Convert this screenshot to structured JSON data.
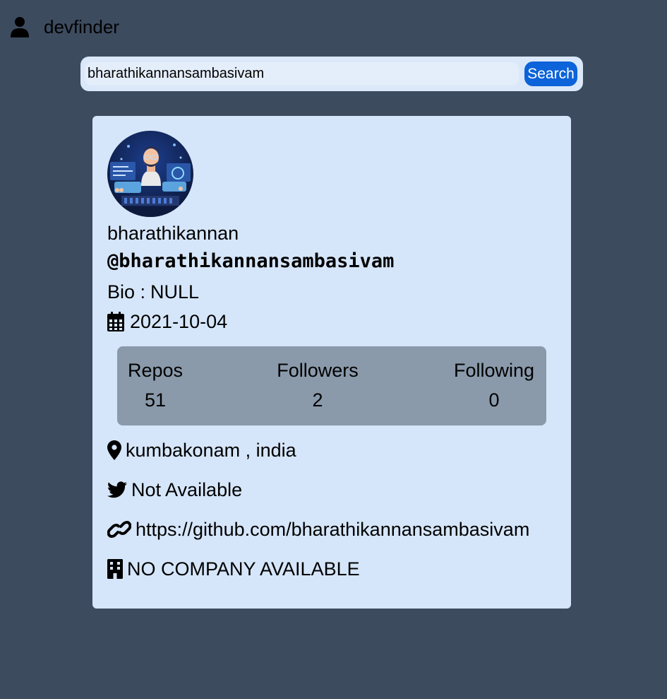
{
  "header": {
    "app_title": "devfinder",
    "icon": "user-icon"
  },
  "search": {
    "value": "bharathikannansambasivam",
    "button_label": "Search"
  },
  "profile": {
    "name": "bharathikannan",
    "login": "@bharathikannansambasivam",
    "bio_label": "Bio :",
    "bio_value": "NULL",
    "joined": "2021-10-04",
    "stats": {
      "repos_label": "Repos",
      "repos_value": "51",
      "followers_label": "Followers",
      "followers_value": "2",
      "following_label": "Following",
      "following_value": "0"
    },
    "location": "kumbakonam , india",
    "twitter": "Not Available",
    "blog": "https://github.com/bharathikannansambasivam",
    "company": "NO COMPANY AVAILABLE"
  },
  "icons": {
    "header": "user-icon",
    "joined": "calendar-icon",
    "location": "map-pin-icon",
    "twitter": "twitter-icon",
    "blog": "link-icon",
    "company": "building-icon"
  },
  "colors": {
    "page_background": "#3d4b5f",
    "card_background": "#d6e6fa",
    "stats_background": "#8a9aab",
    "search_button": "#0d63d9"
  }
}
